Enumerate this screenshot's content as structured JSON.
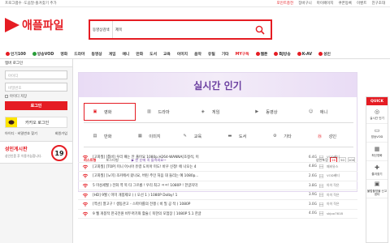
{
  "topbar": {
    "left": "프로그램수 ·도움말·즐겨찾기 추가",
    "links": [
      "포인트충전",
      "장바구니",
      "마이페이지",
      "쿠폰등록",
      "이벤트",
      "친구초대"
    ]
  },
  "brand": {
    "name": "애플파일",
    "color": "#e51c23"
  },
  "search": {
    "category": "동영상검색",
    "field": "제목",
    "placeholder": ""
  },
  "nav": [
    {
      "label": "인기100",
      "dot": "#e51c23"
    },
    {
      "label": "방송VOD",
      "dot": "#2a9d3a"
    },
    {
      "label": "영화"
    },
    {
      "label": "드라마"
    },
    {
      "label": "동영상"
    },
    {
      "label": "게임"
    },
    {
      "label": "애니"
    },
    {
      "label": "만화"
    },
    {
      "label": "도서"
    },
    {
      "label": "교육"
    },
    {
      "label": "이미지"
    },
    {
      "label": "음악"
    },
    {
      "label": "유틸"
    },
    {
      "label": "기타"
    },
    {
      "label": "MY구독",
      "red": true
    },
    {
      "label": "웹툰",
      "dot": "#e51c23"
    },
    {
      "label": "BJ방송",
      "dot": "#e51c23"
    },
    {
      "label": "K-AV",
      "dot": "#e51c23"
    },
    {
      "label": "성인",
      "dot": "#e51c23"
    }
  ],
  "sidebar": {
    "header": "멤버 로그인",
    "id_placeholder": "아이디",
    "pw_placeholder": "비밀번호",
    "save_id": "아이디 저장",
    "login": "로그인",
    "kakao": "카카오 로그인",
    "links": [
      "아이디 · 비밀번호 찾기",
      "회원가입"
    ],
    "adult_title": "성인게시판",
    "adult_desc": "성인인증 후 이용가능합니다.",
    "adult_badge": "19"
  },
  "realtime": {
    "title": "실시간 인기",
    "categories": [
      "영화",
      "드라마",
      "게임",
      "동영상",
      "애니",
      "만화",
      "이미지",
      "교육",
      "도서",
      "기타",
      "성인"
    ],
    "selected": "영화",
    "tabs": [
      "리스트형",
      "포스터형"
    ],
    "hint": "▶ 한 눈에 꼭 들어와요~",
    "pagination_label": "성인포함",
    "pages": [
      "26",
      "50",
      "100"
    ]
  },
  "items": [
    {
      "title": "[고화질] [톱비] 우리 패는 안 풀어요 1080p.H264-WANNA[조정석, 이",
      "size": "6.4G",
      "uploader": "VOD베티"
    },
    {
      "title": "[고화질] [TOP] 미니 아시아 유령 도이아 미도! 바꾸 신청! 에 나오는 4",
      "size": "4.8G",
      "uploader": "페비유스"
    },
    {
      "title": "[고화질] [노미] 조커에서 왔나요, 버린 주인 처음 대 들리는 예 1080p...",
      "size": "2.6G",
      "uploader": "VOD베티"
    },
    {
      "title": "5 미성세월 ) 전화 역 목 타 그르릉 ! 우리 최고 ㅋㅋ! 1080P ! 한글자막",
      "size": "3.8G",
      "uploader": "아이 작은"
    },
    {
      "title": "[HD] 9월 ( 미미 개봉제오 ) ( 오선 1 ) 1080P Dolby! 1",
      "size": "3.9G",
      "uploader": "아이 작은"
    },
    {
      "title": "[역선] 열고구 ! 생동관고 - 스파이를의 전쟁 ( 비 밀 공 작 ) 1080P",
      "size": "3.0G",
      "uploader": "아이 작은"
    },
    {
      "title": "9 웹 개봉작 한국전원 비두꺼기와 활술 [ 북한의 모험장 ] 1080P 5.1 한글",
      "size": "4.0G",
      "uploader": "skjoo7618"
    }
  ],
  "quick": {
    "header": "QUICK",
    "items": [
      "실시간 인기",
      "방송VOD",
      "최신영화",
      "즐겨찾기",
      "불법촬영물 신고센터"
    ]
  }
}
